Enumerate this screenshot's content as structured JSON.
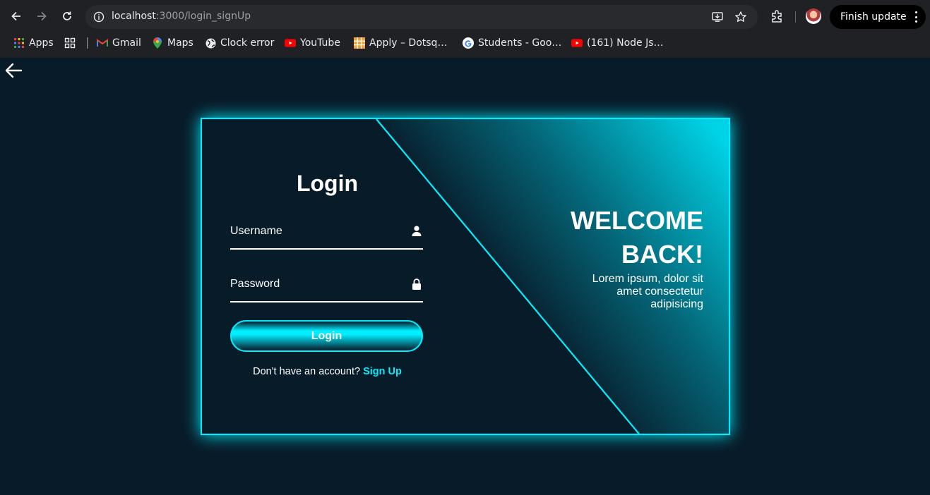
{
  "browser": {
    "url_host": "localhost",
    "url_path": ":3000/login_signUp",
    "finish_update_label": "Finish update"
  },
  "bookmarks": [
    {
      "label": "Apps",
      "icon": "apps-grid-icon"
    },
    {
      "label": "Gmail",
      "icon": "gmail-icon"
    },
    {
      "label": "Maps",
      "icon": "maps-icon"
    },
    {
      "label": "Clock error",
      "icon": "globe-icon"
    },
    {
      "label": "YouTube",
      "icon": "youtube-icon"
    },
    {
      "label": "Apply – Dotsq…",
      "icon": "grid-orange-icon"
    },
    {
      "label": "Students - Goo…",
      "icon": "google-icon"
    },
    {
      "label": "(161) Node Js…",
      "icon": "youtube-icon"
    }
  ],
  "login": {
    "title": "Login",
    "username_label": "Username",
    "password_label": "Password",
    "button_label": "Login",
    "signup_prompt": "Don't have an account?",
    "signup_link": "Sign Up"
  },
  "welcome": {
    "heading_line1": "WELCOME",
    "heading_line2": "BACK!",
    "text": "Lorem ipsum, dolor sit amet consectetur adipisicing"
  },
  "colors": {
    "accent": "#00eeff",
    "background": "#081b29",
    "chrome": "#202124"
  }
}
